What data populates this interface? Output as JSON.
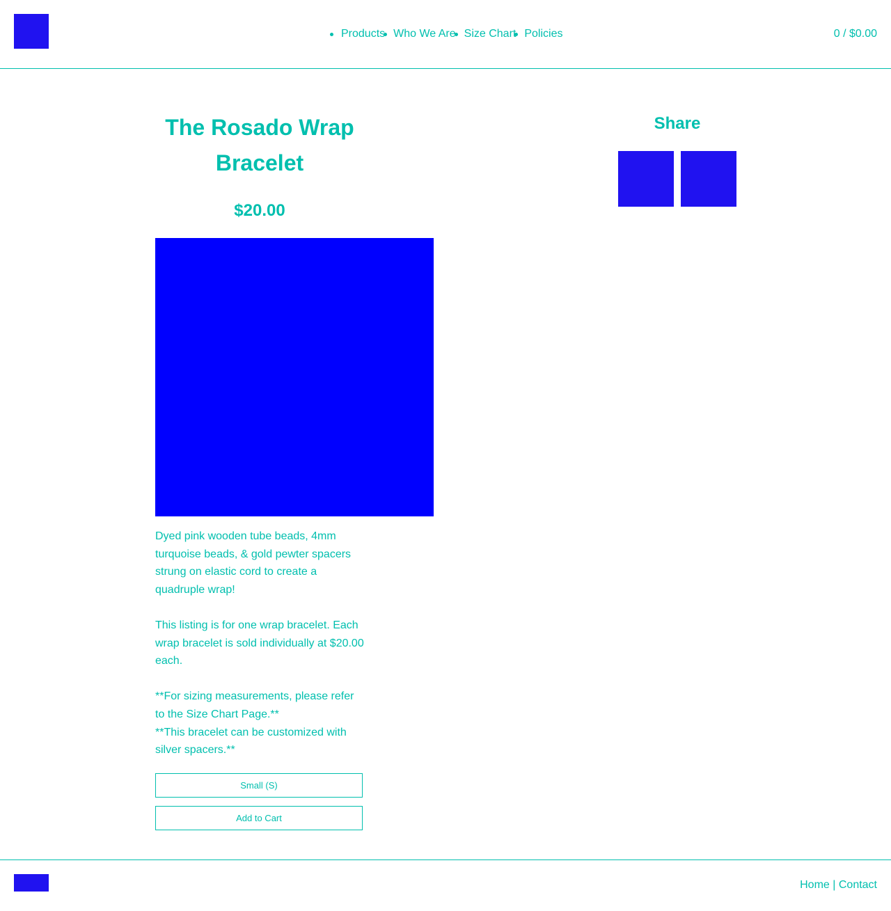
{
  "header": {
    "nav": [
      {
        "label": "Products"
      },
      {
        "label": "Who We Are"
      },
      {
        "label": "Size Chart"
      },
      {
        "label": "Policies"
      }
    ],
    "cart": "0 / $0.00"
  },
  "product": {
    "title": "The Rosado Wrap Bracelet",
    "price": "$20.00",
    "description": [
      "Dyed pink wooden tube beads, 4mm turquoise beads, & gold pewter spacers strung on elastic cord to create a quadruple wrap!",
      "This listing is for one wrap bracelet. Each wrap bracelet is sold individually at $20.00 each.",
      "**For sizing measurements, please refer to the Size Chart Page.**",
      "**This bracelet can be customized with silver spacers.**"
    ],
    "size_selected": "Small (S)",
    "add_to_cart": "Add to Cart"
  },
  "share": {
    "title": "Share"
  },
  "footer": {
    "home": "Home",
    "separator": " | ",
    "contact": "Contact"
  },
  "colors": {
    "accent": "#00bfae",
    "placeholder_blue": "#2012f0",
    "image_blue": "#0000ff"
  }
}
